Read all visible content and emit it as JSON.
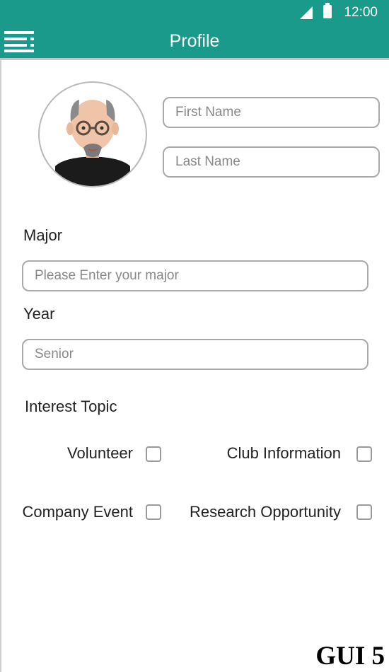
{
  "status_bar": {
    "time": "12:00",
    "icons": [
      "signal-icon",
      "battery-icon"
    ]
  },
  "app_bar": {
    "title": "Profile",
    "menu_icon": "hamburger-menu-icon"
  },
  "colors": {
    "primary": "#1a9a8a",
    "field_border": "#a9a9a9",
    "text": "#222222",
    "placeholder": "#888888"
  },
  "profile": {
    "avatar": "avatar-cartoon-man",
    "first_name": {
      "value": "",
      "placeholder": "First Name"
    },
    "last_name": {
      "value": "",
      "placeholder": "Last Name"
    }
  },
  "major": {
    "label": "Major",
    "value": "",
    "placeholder": "Please Enter your major"
  },
  "year": {
    "label": "Year",
    "value": "",
    "placeholder": "Senior"
  },
  "interests": {
    "label": "Interest Topic",
    "options": [
      {
        "label": "Volunteer",
        "checked": false
      },
      {
        "label": "Club Information",
        "checked": false
      },
      {
        "label": "Company Event",
        "checked": false
      },
      {
        "label": "Research Opportunity",
        "checked": false
      }
    ]
  },
  "caption": "GUI 5"
}
